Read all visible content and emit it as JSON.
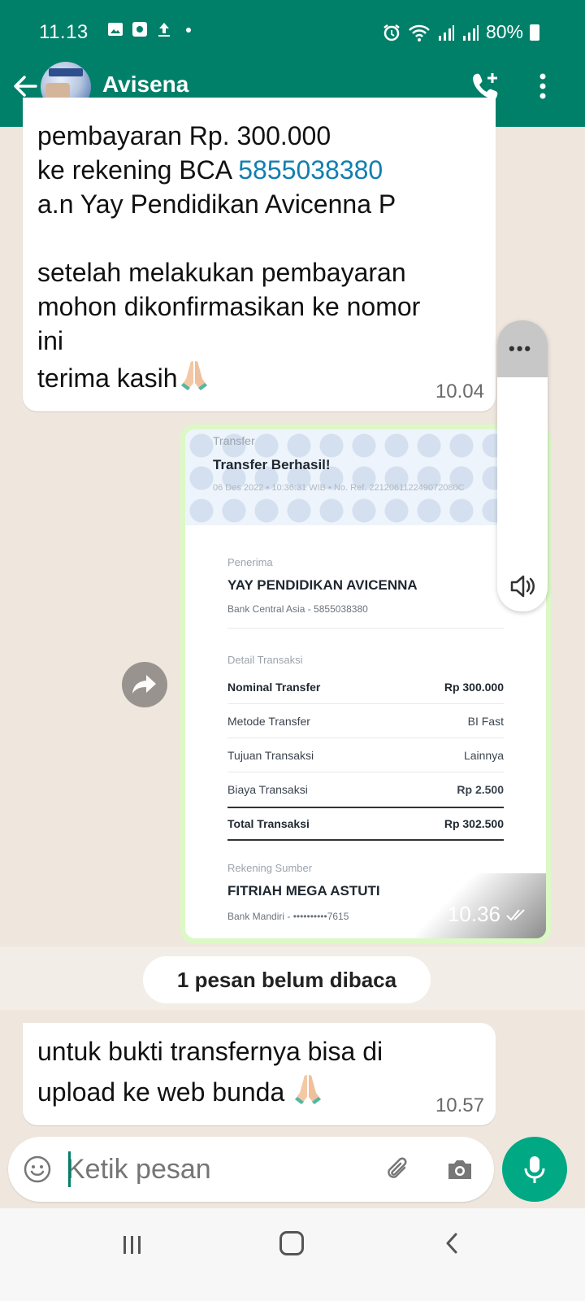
{
  "status": {
    "time": "11.13",
    "battery": "80%",
    "left_icons": [
      "image-icon",
      "app-icon",
      "upload-icon",
      "dot-icon"
    ],
    "right_icons": [
      "alarm-icon",
      "wifi-icon",
      "signal-icon",
      "signal-icon",
      "battery-icon"
    ]
  },
  "header": {
    "contact_name": "Avisena"
  },
  "messages": {
    "m1": {
      "line1": "pembayaran Rp. 300.000",
      "line2_prefix": "ke rekening BCA ",
      "account_link": "5855038380",
      "line3": "a.n Yay Pendidikan Avicenna P",
      "line4": "setelah melakukan pembayaran",
      "line5": "mohon dikonfirmasikan ke nomor",
      "line6": "ini",
      "line7": "terima kasih",
      "time": "10.04"
    },
    "receipt": {
      "label": "Transfer",
      "title": "Transfer Berhasil!",
      "meta": "06 Des 2022 • 10:36:31 WIB • No. Ref. 221206112249072080C",
      "recipient_label": "Penerima",
      "recipient_name": "YAY PENDIDIKAN AVICENNA",
      "recipient_bank": "Bank Central Asia - 5855038380",
      "detail_label": "Detail Transaksi",
      "rows": [
        {
          "k": "Nominal Transfer",
          "v": "Rp 300.000"
        },
        {
          "k": "Metode Transfer",
          "v": "BI Fast"
        },
        {
          "k": "Tujuan Transaksi",
          "v": "Lainnya"
        },
        {
          "k": "Biaya Transaksi",
          "v": "Rp 2.500"
        },
        {
          "k": "Total Transaksi",
          "v": "Rp 302.500"
        }
      ],
      "source_label": "Rekening Sumber",
      "source_name": "FITRIAH MEGA ASTUTI",
      "source_bank": "Bank Mandiri - ••••••••••7615",
      "time": "10.36"
    },
    "unread": "1 pesan belum dibaca",
    "m2": {
      "line1": "untuk bukti transfernya bisa di",
      "line2": "upload ke web bunda",
      "time": "10.57"
    }
  },
  "input": {
    "placeholder": "Ketik pesan"
  },
  "colors": {
    "brand": "#008069",
    "mic": "#00a884",
    "link": "#117fb0",
    "chat_bg": "#efe7de"
  }
}
